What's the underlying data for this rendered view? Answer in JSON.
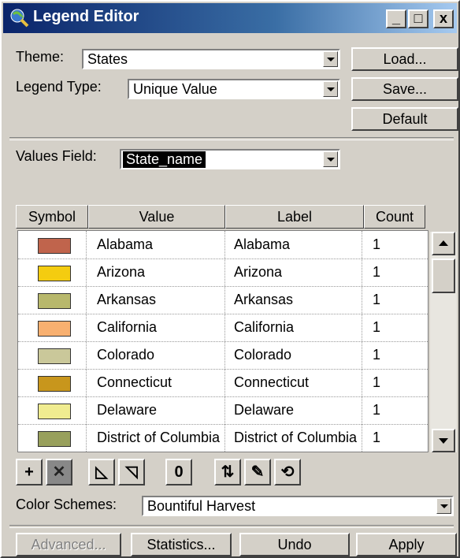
{
  "window": {
    "title": "Legend Editor",
    "controls": {
      "minimize": "_",
      "maximize": "□",
      "close": "x"
    }
  },
  "theme": {
    "label": "Theme:",
    "value": "States"
  },
  "legend_type": {
    "label": "Legend Type:",
    "value": "Unique Value"
  },
  "buttons": {
    "load": "Load...",
    "save": "Save...",
    "default": "Default"
  },
  "values_field": {
    "label": "Values Field:",
    "value": "State_name"
  },
  "table": {
    "headers": [
      "Symbol",
      "Value",
      "Label",
      "Count"
    ],
    "rows": [
      {
        "color": "#c0644c",
        "value": "Alabama",
        "label": "Alabama",
        "count": "1"
      },
      {
        "color": "#f4cc10",
        "value": "Arizona",
        "label": "Arizona",
        "count": "1"
      },
      {
        "color": "#b8b86c",
        "value": "Arkansas",
        "label": "Arkansas",
        "count": "1"
      },
      {
        "color": "#f8b070",
        "value": "California",
        "label": "California",
        "count": "1"
      },
      {
        "color": "#cac89a",
        "value": "Colorado",
        "label": "Colorado",
        "count": "1"
      },
      {
        "color": "#c8961c",
        "value": "Connecticut",
        "label": "Connecticut",
        "count": "1"
      },
      {
        "color": "#f0ec90",
        "value": "Delaware",
        "label": "Delaware",
        "count": "1"
      },
      {
        "color": "#98a05c",
        "value": "District of Columbia",
        "label": "District of Columbia",
        "count": "1"
      }
    ]
  },
  "toolbar": [
    {
      "name": "add-icon",
      "glyph": "+"
    },
    {
      "name": "delete-icon",
      "glyph": "✕"
    },
    {
      "name": "sort-ascending-icon",
      "glyph": "◺"
    },
    {
      "name": "sort-descending-icon",
      "glyph": "◹"
    },
    {
      "name": "null-value-icon",
      "glyph": "0"
    },
    {
      "name": "flip-symbols-icon",
      "glyph": "⇅"
    },
    {
      "name": "symbol-properties-icon",
      "glyph": "✎"
    },
    {
      "name": "symbol-reset-icon",
      "glyph": "⟲"
    }
  ],
  "color_schemes": {
    "label": "Color Schemes:",
    "value": "Bountiful Harvest"
  },
  "bottom_buttons": {
    "advanced": "Advanced...",
    "statistics": "Statistics...",
    "undo": "Undo",
    "apply": "Apply"
  }
}
